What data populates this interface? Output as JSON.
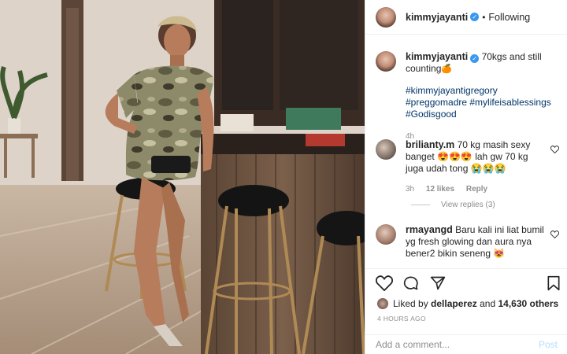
{
  "header": {
    "username": "kimmyjayanti",
    "separator": "•",
    "follow_label": "Following"
  },
  "caption": {
    "username": "kimmyjayanti",
    "text": "70kgs and still counting",
    "emoji": "🍊",
    "hashtags": "#kimmyjayantigregory #preggomadre #mylifeisablessings #Godisgood",
    "time": "4h"
  },
  "comments": [
    {
      "username": "brilianty.m",
      "text": "70 kg masih sexy banget 😍😍😍 lah gw 70 kg juga udah tong 😭😭😭",
      "time": "3h",
      "likes": "12 likes",
      "reply": "Reply"
    },
    {
      "username": "rmayangd",
      "text": "Baru kali ini liat bumil yg fresh glowing dan aura nya bener2 bikin seneng 😻"
    }
  ],
  "view_replies": "View replies (3)",
  "likes": {
    "prefix": "Liked by",
    "user": "dellaperez",
    "and": "and",
    "count": "14,630 others"
  },
  "posted_ago": "4 HOURS AGO",
  "comment_box": {
    "placeholder": "Add a comment...",
    "post_label": "Post"
  },
  "icons": [
    "verified-icon",
    "heart-icon",
    "comment-icon",
    "share-icon",
    "bookmark-icon"
  ],
  "colors": {
    "link": "#003569",
    "verified": "#3897f0",
    "muted": "#8e8e8e",
    "post_disabled": "#b2dffc"
  }
}
